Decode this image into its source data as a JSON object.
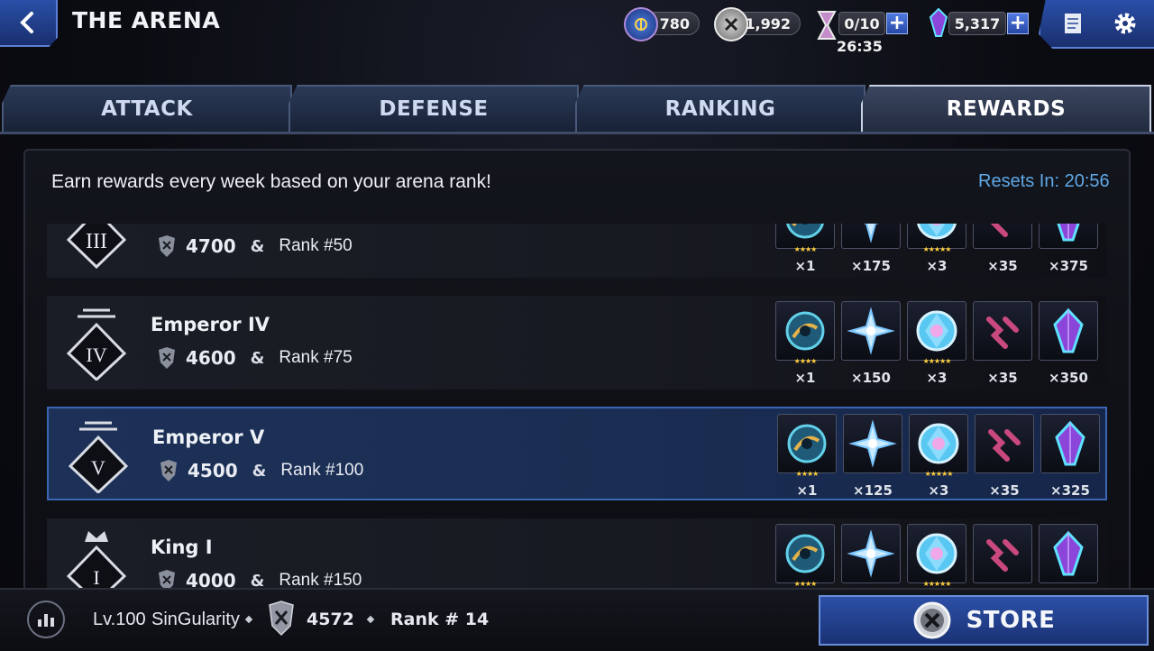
{
  "header": {
    "title": "THE ARENA",
    "medals": "780",
    "arena_coins": "1,992",
    "energy": "0/10",
    "timer": "26:35",
    "crystals": "5,317"
  },
  "tabs": [
    {
      "label": "ATTACK",
      "active": false
    },
    {
      "label": "DEFENSE",
      "active": false
    },
    {
      "label": "RANKING",
      "active": false
    },
    {
      "label": "REWARDS",
      "active": true
    }
  ],
  "panel": {
    "message": "Earn rewards every week based on your arena rank!",
    "resets": "Resets In:  20:56"
  },
  "tiers": [
    {
      "name": "",
      "numeral": "III",
      "points": "4700",
      "amp": "&",
      "rank": "Rank #50",
      "rewards": [
        "×1",
        "×175",
        "×3",
        "×35",
        "×375"
      ],
      "highlight": false
    },
    {
      "name": "Emperor IV",
      "numeral": "IV",
      "points": "4600",
      "amp": "&",
      "rank": "Rank #75",
      "rewards": [
        "×1",
        "×150",
        "×3",
        "×35",
        "×350"
      ],
      "highlight": false
    },
    {
      "name": "Emperor V",
      "numeral": "V",
      "points": "4500",
      "amp": "&",
      "rank": "Rank #100",
      "rewards": [
        "×1",
        "×125",
        "×3",
        "×35",
        "×325"
      ],
      "highlight": true
    },
    {
      "name": "King I",
      "numeral": "I",
      "points": "4000",
      "amp": "&",
      "rank": "Rank #150",
      "rewards": [
        "",
        "",
        "",
        "",
        ""
      ],
      "highlight": false
    }
  ],
  "reward_icons": [
    "gear-chip-icon",
    "star-shard-icon",
    "gem-orb-icon",
    "link-fragment-icon",
    "crystal-icon"
  ],
  "player": {
    "level": "Lv.100",
    "name": "SinGularity",
    "points": "4572",
    "rank": "Rank # 14"
  },
  "store": {
    "label": "STORE"
  },
  "colors": {
    "accent_blue": "#2c4fa6",
    "highlight_row": "#1d3158",
    "resets_text": "#5fa8e6",
    "star_gold": "#ffcf3d"
  }
}
